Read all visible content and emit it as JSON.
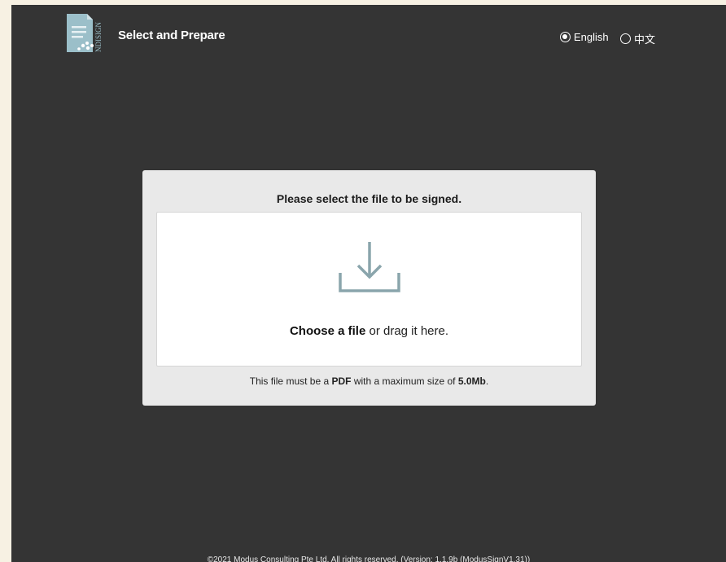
{
  "header": {
    "logo_text": "NDISIGN",
    "title": "Select and Prepare",
    "languages": [
      {
        "label": "English",
        "selected": true
      },
      {
        "label": "中文",
        "selected": false
      }
    ]
  },
  "upload": {
    "title": "Please select the file to be signed.",
    "choose_link": "Choose a file",
    "drag_text": " or drag it here.",
    "hint_prefix": "This file must be a ",
    "hint_format": "PDF",
    "hint_middle": " with a maximum size of ",
    "hint_size": "5.0Mb",
    "hint_suffix": "."
  },
  "footer": {
    "text": "©2021 Modus Consulting Pte Ltd. All rights reserved. (Version: 1.1.9b (ModusSignV1.31))"
  },
  "colors": {
    "background": "#343434",
    "panel": "#e9e9e9",
    "icon": "#8aa5ac",
    "logo": "#9bbfc9"
  }
}
